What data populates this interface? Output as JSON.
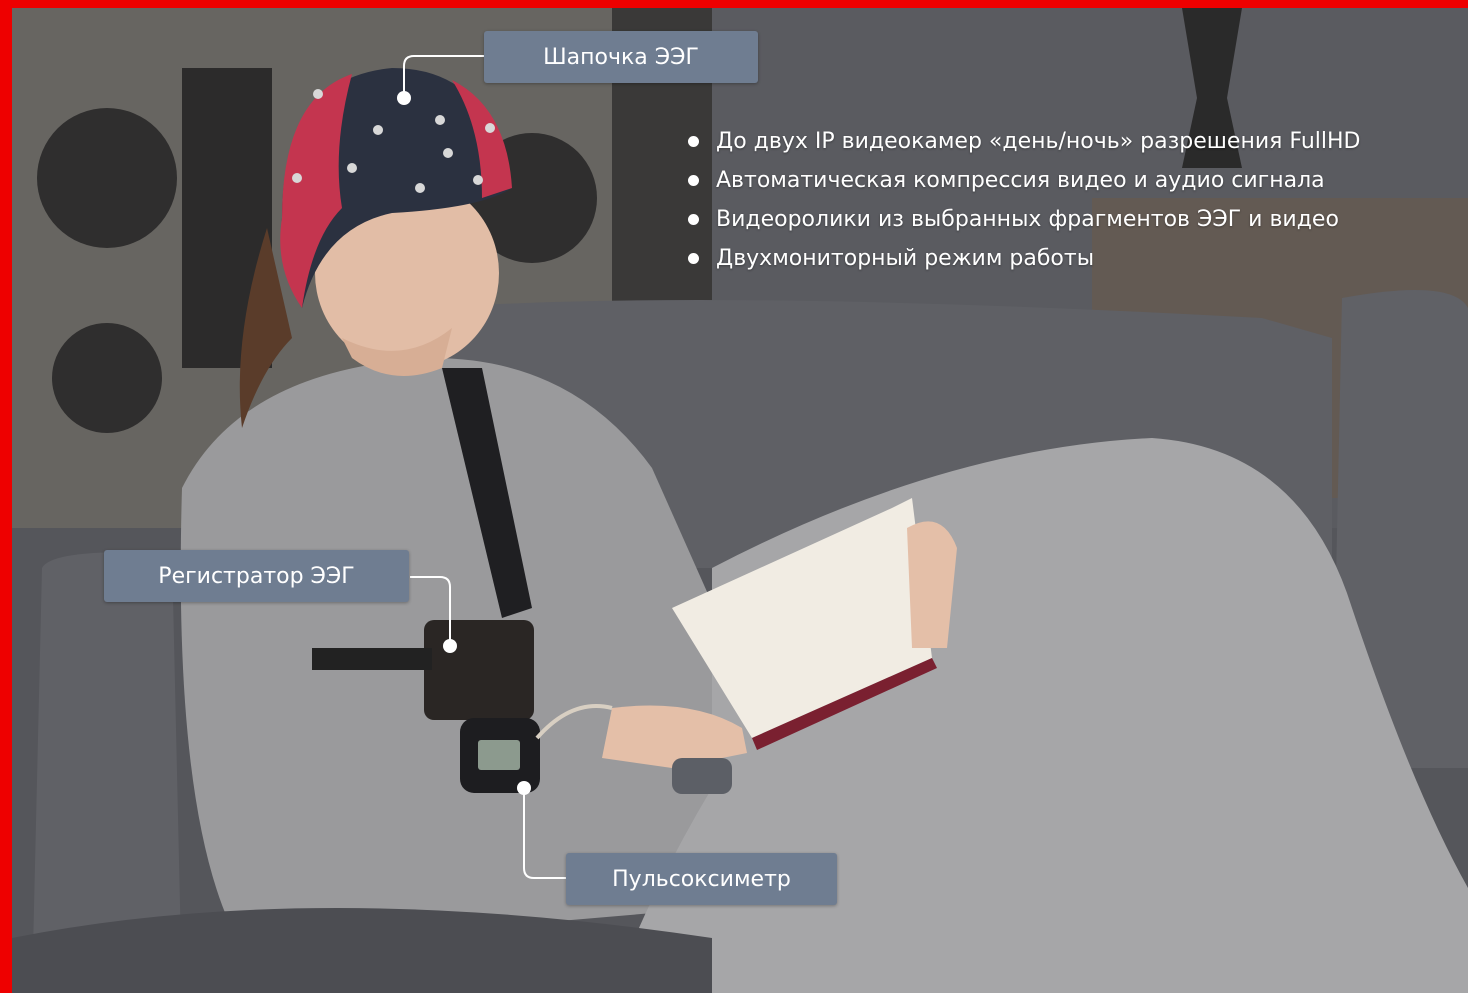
{
  "callouts": {
    "eeg_cap": "Шапочка ЭЭГ",
    "eeg_recorder": "Регистратор ЭЭГ",
    "pulse_oximeter": "Пульсоксиметр"
  },
  "features": [
    "До двух IP видеокамер «день/ночь» разрешения FullHD",
    "Автоматическая компрессия видео и аудио сигнала",
    "Видеоролики из выбранных фрагментов ЭЭГ и видео",
    "Двухмониторный режим работы"
  ],
  "colors": {
    "frame": "#ee0000",
    "callout_bg": "#6f7d91",
    "text": "#ffffff"
  }
}
